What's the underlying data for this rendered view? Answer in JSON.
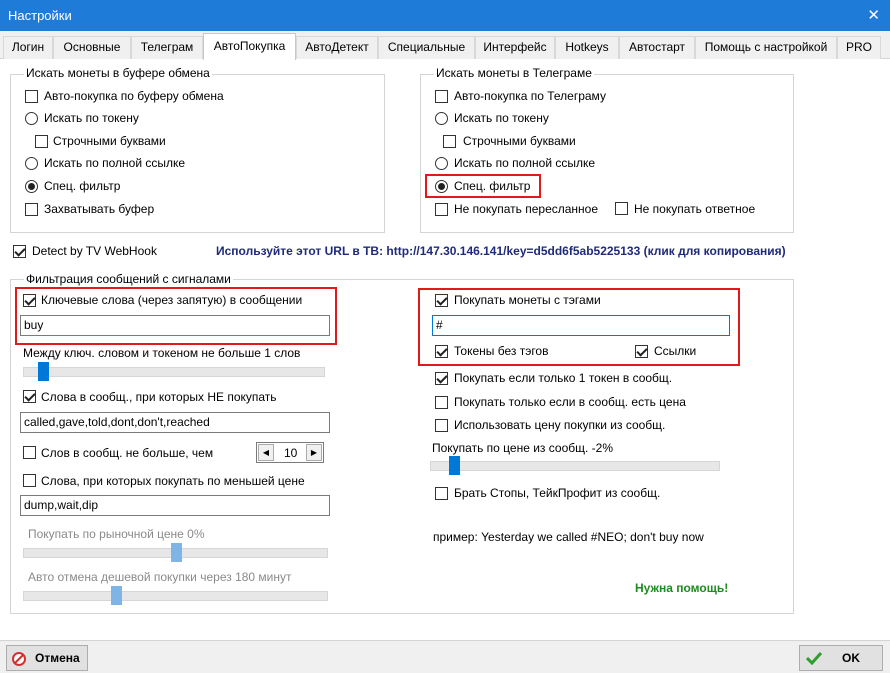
{
  "window": {
    "title": "Настройки",
    "close_icon": "close-icon"
  },
  "tabs": [
    {
      "label": "Логин"
    },
    {
      "label": "Основные"
    },
    {
      "label": "Телеграм"
    },
    {
      "label": "АвтоПокупка"
    },
    {
      "label": "АвтоДетект"
    },
    {
      "label": "Специальные"
    },
    {
      "label": "Интерфейс"
    },
    {
      "label": "Hotkeys"
    },
    {
      "label": "Автостарт"
    },
    {
      "label": "Помощь с настройкой"
    },
    {
      "label": "PRO"
    }
  ],
  "buffer": {
    "title": "Искать монеты в буфере обмена",
    "auto_buy": "Авто-покупка по буферу обмена",
    "by_token": "Искать по токену",
    "lowercase": "Строчными буквами",
    "by_full_link": "Искать по полной ссылке",
    "special_filter": "Спец. фильтр",
    "capture_buffer": "Захватывать буфер"
  },
  "telegram": {
    "title": "Искать монеты в Телеграме",
    "auto_buy": "Авто-покупка по Телеграму",
    "by_token": "Искать по токену",
    "lowercase": "Строчными буквами",
    "by_full_link": "Искать по полной ссылке",
    "special_filter": "Спец. фильтр",
    "no_forwarded": "Не покупать пересланное",
    "no_replies": "Не покупать ответное"
  },
  "webhook": {
    "label": "Detect by TV WebHook",
    "url_text": "Используйте этот URL в ТВ: http://147.30.146.141/key=d5dd6f5ab5225133 (клик для копирования)"
  },
  "filter": {
    "title": "Фильтрация сообщений с сигналами",
    "keywords_label": "Ключевые слова (через запятую) в сообщении",
    "keywords_value": "buy",
    "distance_label": "Между ключ. словом и токеном не больше 1 слов",
    "distance_slider": 1,
    "exclude_label": "Слова в сообщ., при которых НЕ покупать",
    "exclude_value": "called,gave,told,dont,don't,reached",
    "max_words_label": "Слов в сообщ. не больше, чем",
    "max_words_value": "10",
    "lower_price_label": "Слова, при которых покупать по меньшей цене",
    "lower_price_value": "dump,wait,dip",
    "market_price_label": "Покупать по рыночной цене 0%",
    "market_price_slider": 0,
    "auto_cancel_label": "Авто отмена дешевой покупки через 180 минут",
    "auto_cancel_slider": 180,
    "tags_label": "Покупать монеты с тэгами",
    "tags_value": "#",
    "no_tags_label": "Токены без тэгов",
    "links_label": "Ссылки",
    "only_one_label": "Покупать если только 1 токен в сообщ.",
    "only_price_label": "Покупать только если в сообщ. есть цена",
    "use_price_label": "Использовать цену покупки из сообщ.",
    "price_from_msg_label": "Покупать по цене из сообщ. -2%",
    "price_from_msg_slider": -2,
    "stops_label": "Брать Стопы, ТейкПрофит из сообщ.",
    "example": "пример: Yesterday we called #NEO; don't buy now",
    "help": "Нужна помощь!"
  },
  "buttons": {
    "cancel": "Отмена",
    "ok": "OK"
  },
  "colors": {
    "titlebar": "#1e7bd8",
    "highlight": "#e01a1a",
    "link": "#1f2a7a",
    "help": "#1f8a1f",
    "slider": "#0078d7"
  }
}
